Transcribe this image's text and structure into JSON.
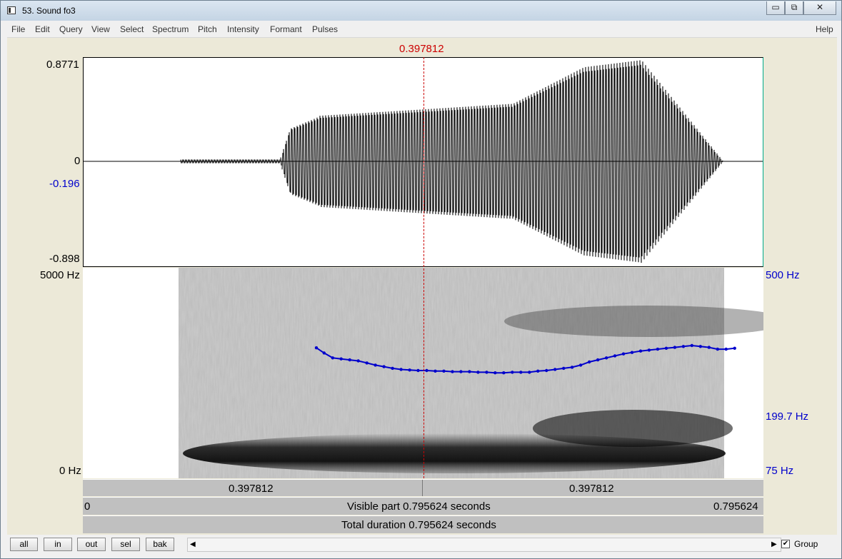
{
  "window": {
    "title": "53. Sound fo3",
    "minimize": "▭",
    "maximize": "⧉",
    "close": "✕"
  },
  "menu": {
    "items": [
      "File",
      "Edit",
      "Query",
      "View",
      "Select",
      "Spectrum",
      "Pitch",
      "Intensity",
      "Formant",
      "Pulses"
    ],
    "help": "Help"
  },
  "cursor": {
    "time": "0.397812"
  },
  "waveform": {
    "ymax": "0.8771",
    "zero": "0",
    "cursor_value": "-0.196",
    "ymin": "-0.898"
  },
  "spectrogram": {
    "freq_top": "5000 Hz",
    "freq_bottom": "0 Hz",
    "pitch_top": "500 Hz",
    "pitch_mid": "199.7 Hz",
    "pitch_bottom": "75 Hz"
  },
  "pitch_contour": {
    "t": [
      0.273,
      0.282,
      0.292,
      0.302,
      0.312,
      0.322,
      0.332,
      0.342,
      0.352,
      0.362,
      0.372,
      0.382,
      0.392,
      0.402,
      0.412,
      0.422,
      0.432,
      0.442,
      0.452,
      0.462,
      0.472,
      0.482,
      0.492,
      0.502,
      0.512,
      0.522,
      0.532,
      0.542,
      0.552,
      0.562,
      0.572,
      0.582,
      0.592,
      0.602,
      0.612,
      0.622,
      0.632,
      0.642,
      0.652,
      0.662,
      0.672,
      0.682,
      0.692,
      0.702,
      0.712,
      0.722,
      0.732,
      0.742,
      0.752,
      0.762
    ],
    "hz": [
      243,
      232,
      222,
      220,
      218,
      216,
      212,
      208,
      205,
      202,
      200,
      199,
      198,
      198,
      197,
      197,
      196,
      196,
      196,
      195,
      195,
      194,
      194,
      195,
      195,
      195,
      197,
      198,
      200,
      202,
      204,
      208,
      214,
      218,
      222,
      226,
      230,
      233,
      236,
      238,
      240,
      242,
      244,
      246,
      248,
      246,
      244,
      240,
      240,
      242
    ]
  },
  "time_bars": {
    "left_half": "0.397812",
    "right_half": "0.397812",
    "start": "0",
    "visible_label": "Visible part 0.795624 seconds",
    "end": "0.795624",
    "total_label": "Total duration 0.795624 seconds"
  },
  "buttons": {
    "all": "all",
    "in": "in",
    "out": "out",
    "sel": "sel",
    "bak": "bak",
    "group_label": "Group",
    "group_checked": "✔",
    "scroll_left": "◀",
    "scroll_right": "▶"
  },
  "colors": {
    "cursor": "#cc0000",
    "pitch": "#0000cc",
    "waveform": "#000000"
  }
}
